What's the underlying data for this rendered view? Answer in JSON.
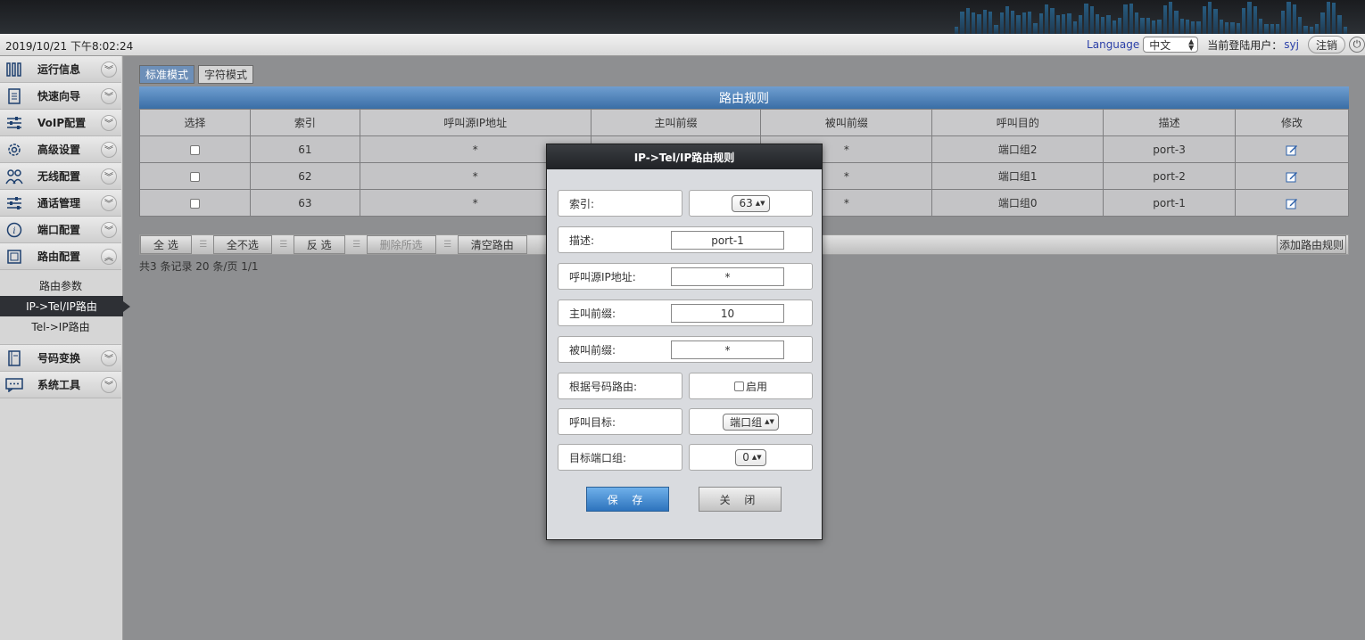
{
  "header": {
    "datetime": "2019/10/21 下午8:02:24",
    "language_label": "Language",
    "language_value": "中文",
    "user_label": "当前登陆用户：",
    "user_name": "syj",
    "logout_label": "注销"
  },
  "sidebar": {
    "items": [
      {
        "label": "运行信息",
        "icon": "bars-icon"
      },
      {
        "label": "快速向导",
        "icon": "document-icon"
      },
      {
        "label": "VoIP配置",
        "icon": "sliders-icon"
      },
      {
        "label": "高级设置",
        "icon": "gear-icon"
      },
      {
        "label": "无线配置",
        "icon": "users-icon"
      },
      {
        "label": "通话管理",
        "icon": "sliders-icon"
      },
      {
        "label": "端口配置",
        "icon": "info-icon"
      },
      {
        "label": "路由配置",
        "icon": "square-icon"
      }
    ],
    "submenu": [
      {
        "label": "路由参数"
      },
      {
        "label": "IP->Tel/IP路由"
      },
      {
        "label": "Tel->IP路由"
      }
    ],
    "items_after": [
      {
        "label": "号码变换",
        "icon": "notebook-icon"
      },
      {
        "label": "系统工具",
        "icon": "chat-icon"
      }
    ]
  },
  "main": {
    "tabs": [
      {
        "label": "标准模式"
      },
      {
        "label": "字符模式"
      }
    ],
    "table_title": "路由规则",
    "columns": [
      "选择",
      "索引",
      "呼叫源IP地址",
      "主叫前缀",
      "被叫前缀",
      "呼叫目的",
      "描述",
      "修改"
    ],
    "rows": [
      {
        "index": "61",
        "src_ip": "*",
        "caller": "",
        "callee": "*",
        "dest": "端口组2",
        "desc": "port-3"
      },
      {
        "index": "62",
        "src_ip": "*",
        "caller": "",
        "callee": "*",
        "dest": "端口组1",
        "desc": "port-2"
      },
      {
        "index": "63",
        "src_ip": "*",
        "caller": "",
        "callee": "*",
        "dest": "端口组0",
        "desc": "port-1"
      }
    ],
    "actions": {
      "select_all": "全 选",
      "select_none": "全不选",
      "invert": "反 选",
      "delete_selected": "删除所选",
      "clear": "清空路由",
      "add": "添加路由规则"
    },
    "records": "共3 条记录 20 条/页 1/1"
  },
  "modal": {
    "title": "IP->Tel/IP路由规则",
    "index_label": "索引:",
    "index_value": "63",
    "desc_label": "描述:",
    "desc_value": "port-1",
    "src_ip_label": "呼叫源IP地址:",
    "src_ip_value": "*",
    "caller_label": "主叫前缀:",
    "caller_value": "10",
    "callee_label": "被叫前缀:",
    "callee_value": "*",
    "by_number_label": "根据号码路由:",
    "by_number_option": "启用",
    "target_label": "呼叫目标:",
    "target_value": "端口组",
    "port_group_label": "目标端口组:",
    "port_group_value": "0",
    "save_label": "保 存",
    "close_label": "关 闭"
  }
}
